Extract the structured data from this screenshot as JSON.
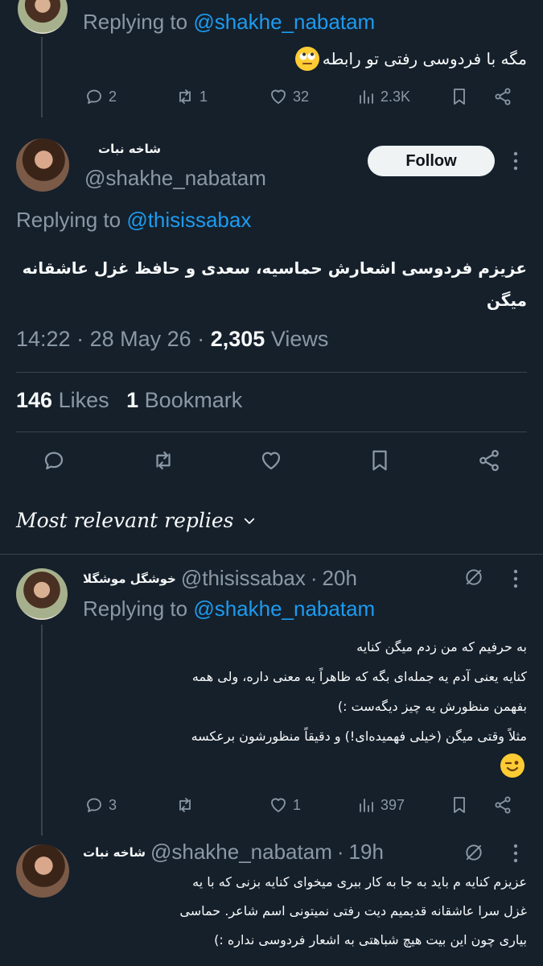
{
  "top_tweet": {
    "replying_label": "Replying to",
    "replying_handle": "@shakhe_nabatam",
    "text": "مگه با فردوسی رفتی تو رابطه",
    "emoji": "face-with-rolling-eyes",
    "stats": {
      "replies": "2",
      "retweets": "1",
      "likes": "32",
      "views": "2.3K"
    }
  },
  "main_tweet": {
    "author_name": "شاخه نبات",
    "author_handle": "@shakhe_nabatam",
    "follow_label": "Follow",
    "replying_label": "Replying to",
    "replying_handle": "@thisissabax",
    "text_line1": "عزیزم فردوسی اشعارش حماسیه، سعدی و حافظ غزل عاشقانه",
    "text_line2": "میگن",
    "time": "14:22",
    "date": "28 May 26",
    "views_count": "2,305",
    "views_label": "Views",
    "likes_count": "146",
    "likes_label": "Likes",
    "bookmarks_count": "1",
    "bookmarks_label": "Bookmark"
  },
  "sort": {
    "label": "Most relevant replies"
  },
  "reply1": {
    "author_name": "خوشگل موشگلا",
    "author_handle": "@thisissabax",
    "age": "20h",
    "replying_label": "Replying to",
    "replying_handle": "@shakhe_nabatam",
    "lines": [
      "به حرفیم که من زدم میگن کنایه",
      "کنایه یعنی آدم یه جمله‌ای بگه که ظاهراً یه معنی داره، ولی همه",
      "بفهمن منظورش یه چیز دیگه‌ست :)",
      "مثلاً وقتی میگن (خیلی فهمیده‌ای!) و دقیقاً منظورشون برعکسه"
    ],
    "emoji": "winking-face",
    "stats": {
      "replies": "3",
      "retweets": "",
      "likes": "1",
      "views": "397"
    }
  },
  "reply2": {
    "author_name": "شاخه نبات",
    "author_handle": "@shakhe_nabatam",
    "age": "19h",
    "lines": [
      "عزیزم کنایه م باید به جا به کار ببری میخوای کنایه بزنی که با یه",
      "غزل سرا عاشقانه قدیمیم دیت رفتی نمیتونی اسم شاعر. حماسی",
      "بیاری چون این بیت هیچ شباهتی به اشعار فردوسی نداره :)"
    ]
  }
}
